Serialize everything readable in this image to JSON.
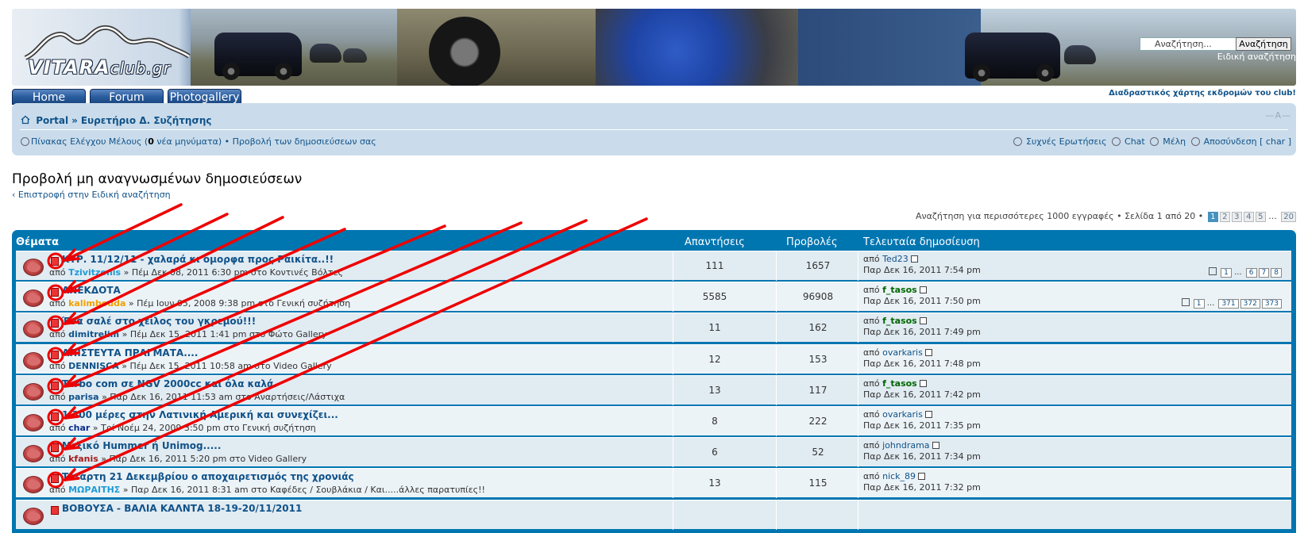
{
  "header": {
    "logo_main": "VITARA",
    "logo_sub": "club.gr",
    "search_placeholder": "Αναζήτηση...",
    "search_button": "Αναζήτηση",
    "advanced_search": "Ειδική αναζήτηση",
    "map_link": "Διαδραστικός χάρτης εκδρομών του club!"
  },
  "tabs": [
    "Home",
    "Forum",
    "Photogallery"
  ],
  "navbar": {
    "breadcrumbs": [
      "Portal",
      "Ευρετήριο Δ. Συζήτησης"
    ],
    "font_size_control": "—A—",
    "ucp_prefix": "Πίνακας Ελέγχου Μέλους (",
    "ucp_count": "0",
    "ucp_suffix": " νέα μηνύματα)",
    "own_posts": "Προβολή των δημοσιεύσεων σας",
    "faq": "Συχνές Ερωτήσεις",
    "chat": "Chat",
    "members": "Μέλη",
    "logout": "Αποσύνδεση [ char ]"
  },
  "page": {
    "title": "Προβολή μη αναγνωσμένων δημοσιεύσεων",
    "back_link": "Επιστροφή στην Ειδική αναζήτηση",
    "search_results": "Αναζήτηση για περισσότερες 1000 εγγραφές",
    "page_label": "Σελίδα 1 από 20",
    "pages": [
      "1",
      "2",
      "3",
      "4",
      "5",
      "...",
      "20"
    ]
  },
  "table": {
    "headers": {
      "topics": "Θέματα",
      "replies": "Απαντήσεις",
      "views": "Προβολές",
      "last_post": "Τελευταία δημοσίευση"
    },
    "rows": [
      {
        "title": "ΚΥΡ. 11/12/11 - χαλαρά κι όμορφα προς Ραικίτα..!!",
        "author": "Tzivitzonis",
        "author_color": "#1e9bd6",
        "meta": " » Πέμ Δεκ 08, 2011 6:30 pm στο Κοντινές Βόλτες",
        "pages": [
          "1",
          "...",
          "6",
          "7",
          "8"
        ],
        "replies": "111",
        "views": "1657",
        "last_author": "Ted23",
        "last_mod": false,
        "last_time": "Παρ Δεκ 16, 2011 7:54 pm",
        "hot": true
      },
      {
        "title": "ΑΝΕΚΔΟΤΑ",
        "author": "kalimbouda",
        "author_color": "#f0a000",
        "meta": " » Πέμ Ιουν 05, 2008 9:38 pm στο Γενική συζήτηση",
        "pages": [
          "1",
          "...",
          "371",
          "372",
          "373"
        ],
        "replies": "5585",
        "views": "96908",
        "last_author": "f_tasos",
        "last_mod": true,
        "last_time": "Παρ Δεκ 16, 2011 7:50 pm",
        "hot": true
      },
      {
        "title": "Ένα σαλέ στο χείλος του γκρεμού!!!",
        "author": "dimitrelim",
        "author_color": "#105289",
        "meta": " » Πέμ Δεκ 15, 2011 1:41 pm στο Φώτο Gallery",
        "pages": [],
        "replies": "11",
        "views": "162",
        "last_author": "f_tasos",
        "last_mod": true,
        "last_time": "Παρ Δεκ 16, 2011 7:49 pm",
        "hot": false
      },
      {
        "title": "ΑΠΙΣΤΕΥΤΑ ΠΡΑΓΜΑΤΑ....",
        "author": "DENNISCA",
        "author_color": "#105289",
        "meta": " » Πέμ Δεκ 15, 2011 10:58 am στο Video Gallery",
        "pages": [],
        "replies": "12",
        "views": "153",
        "last_author": "ovarkaris",
        "last_mod": false,
        "last_time": "Παρ Δεκ 16, 2011 7:48 pm",
        "hot": false
      },
      {
        "title": "Turbo com σε NGV 2000cc και όλα καλά.",
        "author": "parisa",
        "author_color": "#105289",
        "meta": " » Παρ Δεκ 16, 2011 11:53 am στο Αναρτήσεις/Λάστιχα",
        "pages": [],
        "replies": "13",
        "views": "117",
        "last_author": "f_tasos",
        "last_mod": true,
        "last_time": "Παρ Δεκ 16, 2011 7:42 pm",
        "hot": false
      },
      {
        "title": "1.300 μέρες στην Λατινική Αμερική και συνεχίζει...",
        "author": "char",
        "author_color": "#0b2b8f",
        "meta": " » Τρί Νοέμ 24, 2009 3:50 pm στο Γενική συζήτηση",
        "pages": [],
        "replies": "8",
        "views": "222",
        "last_author": "ovarkaris",
        "last_mod": false,
        "last_time": "Παρ Δεκ 16, 2011 7:35 pm",
        "hot": false
      },
      {
        "title": "Μεξικό Hummer ή Unimog.....",
        "author": "kfanis",
        "author_color": "#a31d1d",
        "meta": " » Παρ Δεκ 16, 2011 5:20 pm στο Video Gallery",
        "pages": [],
        "replies": "6",
        "views": "52",
        "last_author": "johndrama",
        "last_mod": false,
        "last_time": "Παρ Δεκ 16, 2011 7:34 pm",
        "hot": false
      },
      {
        "title": "Τετάρτη 21 Δεκεμβρίου ο αποχαιρετισμός της χρονιάς",
        "author": "ΜΩΡΑΙΤΗΣ",
        "author_color": "#1e9bd6",
        "meta": " » Παρ Δεκ 16, 2011 8:31 am στο Καφέδες / Σουβλάκια / Και.....άλλες παρατυπίες!!",
        "pages": [],
        "replies": "13",
        "views": "115",
        "last_author": "nick_89",
        "last_mod": false,
        "last_time": "Παρ Δεκ 16, 2011 7:32 pm",
        "hot": false
      },
      {
        "title": "ΒΟΒΟΥΣΑ - ΒΑΛΙΑ ΚΑΛΝΤΑ 18-19-20/11/2011",
        "author": "",
        "author_color": "#105289",
        "meta": "",
        "pages": [],
        "replies": "",
        "views": "",
        "last_author": "",
        "last_mod": false,
        "last_time": "",
        "hot": false
      }
    ],
    "by_prefix": "από "
  },
  "colors": {
    "table_header": "#0076b1",
    "annotation": "#ee0000",
    "link": "#105289"
  }
}
